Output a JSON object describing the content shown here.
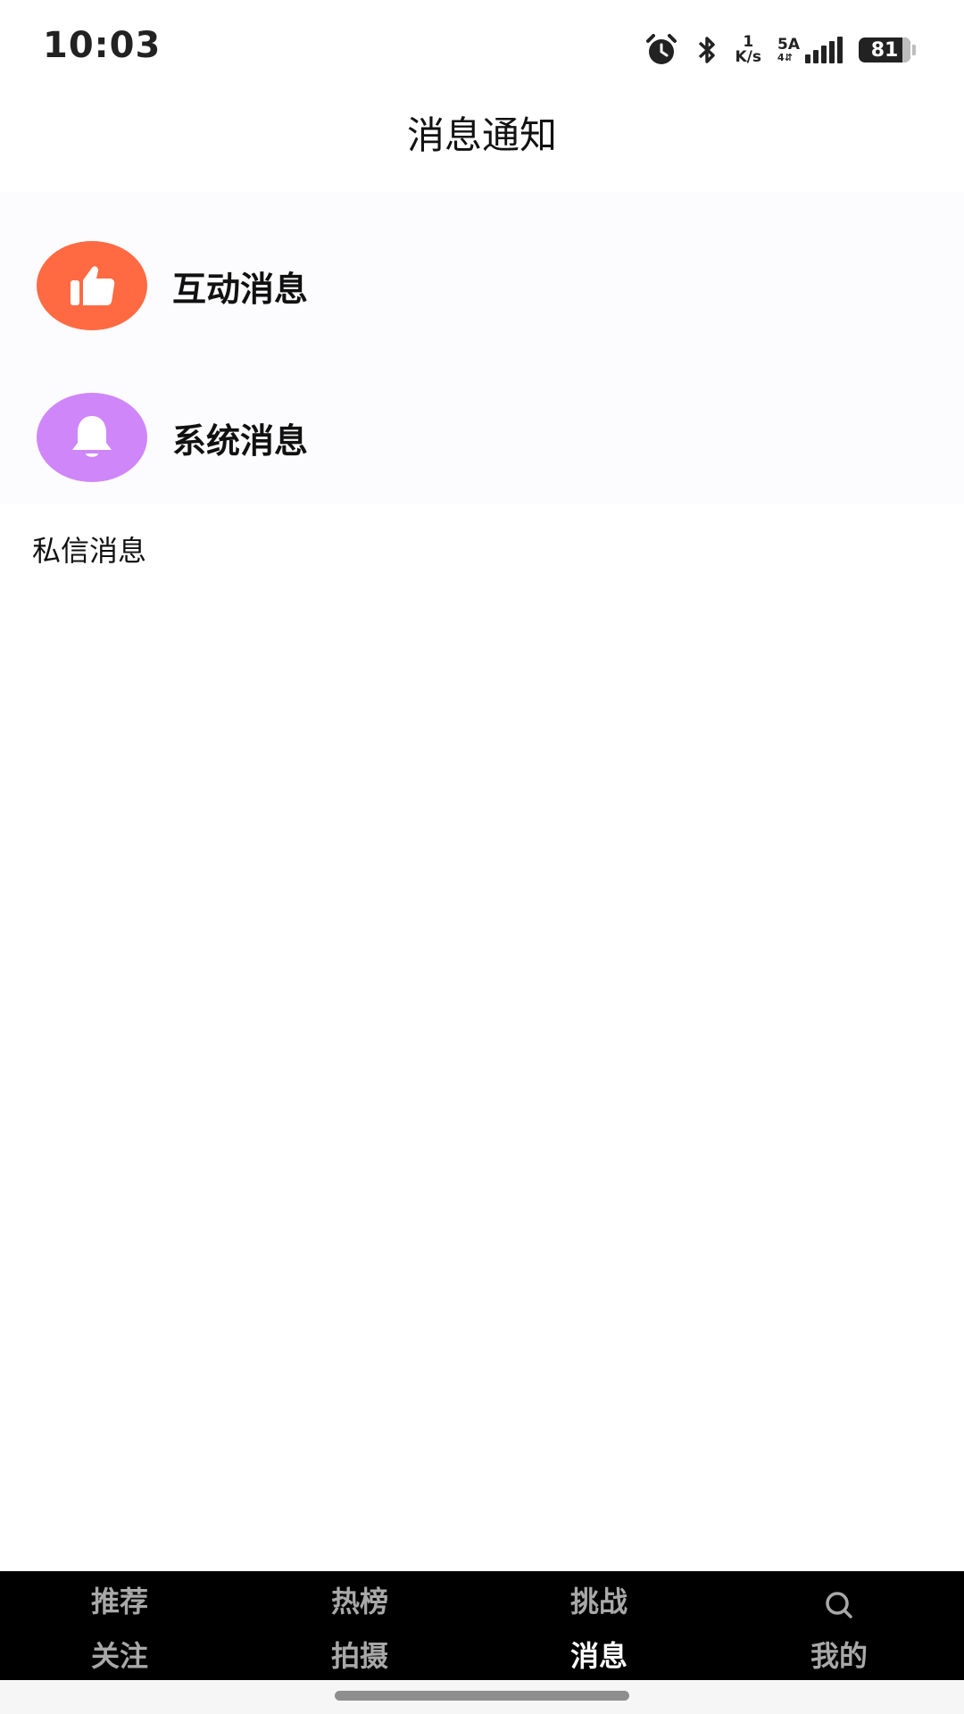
{
  "status_bar": {
    "time": "10:03",
    "net_speed_value": "1",
    "net_speed_unit": "K/s",
    "signal_label_top": "5A",
    "signal_label_bottom": "4⇵",
    "battery": "81"
  },
  "header": {
    "title": "消息通知"
  },
  "notifications": [
    {
      "label": "互动消息",
      "icon": "thumbs-up-icon",
      "color": "#ff6a43"
    },
    {
      "label": "系统消息",
      "icon": "bell-icon",
      "color": "#cf86f8"
    }
  ],
  "private_section": {
    "title": "私信消息"
  },
  "bottom_nav": {
    "row1": [
      "推荐",
      "热榜",
      "挑战"
    ],
    "row1_icon": "search-icon",
    "row2": [
      "关注",
      "拍摄",
      "消息",
      "我的"
    ],
    "active": "消息"
  }
}
